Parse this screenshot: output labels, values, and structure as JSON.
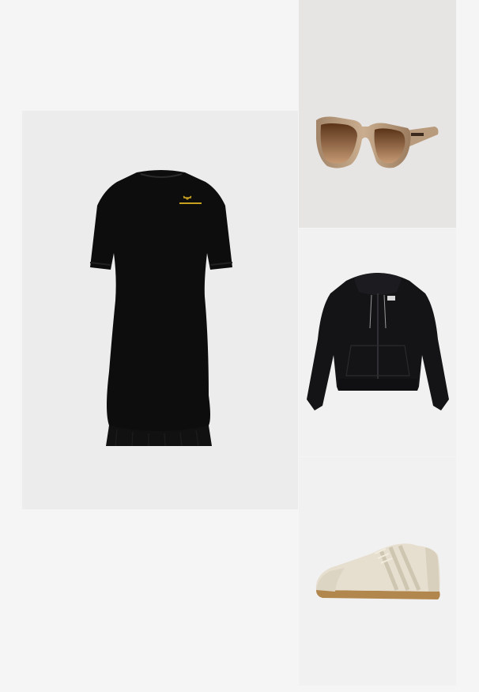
{
  "outfit": {
    "items": [
      {
        "product": "dress",
        "icon": "dress-image",
        "color": "#0d0d0d"
      },
      {
        "product": "sunglasses",
        "icon": "sunglasses-image",
        "color": "#a07a58"
      },
      {
        "product": "hoodie",
        "icon": "hoodie-image",
        "color": "#141416"
      },
      {
        "product": "sneaker",
        "icon": "sneaker-image",
        "color": "#e6dfcf"
      }
    ]
  },
  "colors": {
    "page_background": "#f5f5f5",
    "tile_background": "#ececec"
  }
}
